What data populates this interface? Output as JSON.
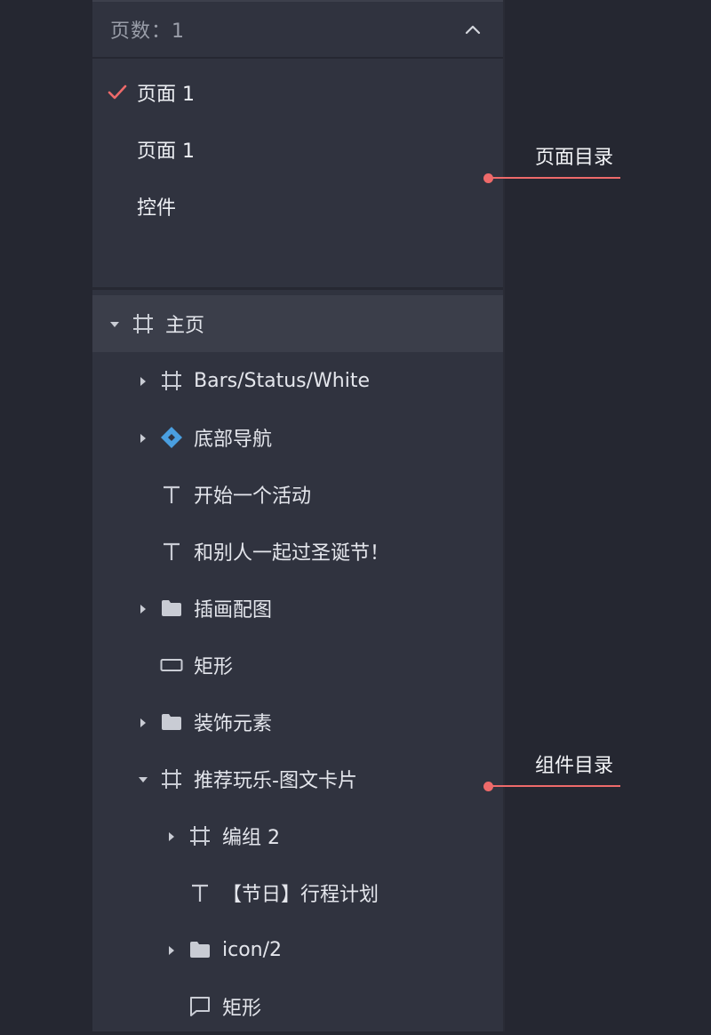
{
  "header": {
    "title": "页数：1"
  },
  "pages": [
    {
      "label": "页面 1",
      "checked": true
    },
    {
      "label": "页面 1",
      "checked": false
    },
    {
      "label": "控件",
      "checked": false
    }
  ],
  "layers": [
    {
      "label": "主页",
      "icon": "artboard-icon",
      "expand": "expanded",
      "level": 0,
      "selected": true
    },
    {
      "label": "Bars/Status/White",
      "icon": "artboard-icon",
      "expand": "collapsed",
      "level": 1
    },
    {
      "label": "底部导航",
      "icon": "symbol-diamond-icon",
      "expand": "collapsed",
      "level": 1
    },
    {
      "label": "开始一个活动",
      "icon": "text-icon",
      "expand": "none",
      "level": 1
    },
    {
      "label": "和别人一起过圣诞节！",
      "icon": "text-icon",
      "expand": "none",
      "level": 1
    },
    {
      "label": "插画配图",
      "icon": "folder-icon",
      "expand": "collapsed",
      "level": 1
    },
    {
      "label": "矩形",
      "icon": "rectangle-icon",
      "expand": "none",
      "level": 1
    },
    {
      "label": "装饰元素",
      "icon": "folder-icon",
      "expand": "collapsed",
      "level": 1
    },
    {
      "label": "推荐玩乐-图文卡片",
      "icon": "artboard-icon",
      "expand": "expanded",
      "level": 1
    },
    {
      "label": "编组 2",
      "icon": "artboard-icon",
      "expand": "collapsed",
      "level": 2
    },
    {
      "label": "【节日】行程计划",
      "icon": "text-icon",
      "expand": "none",
      "level": 2
    },
    {
      "label": "icon/2",
      "icon": "folder-icon",
      "expand": "collapsed",
      "level": 2
    },
    {
      "label": "矩形",
      "icon": "shape-path-icon",
      "expand": "none",
      "level": 2
    }
  ],
  "annotations": {
    "pages_label": "页面目录",
    "layers_label": "组件目录"
  },
  "colors": {
    "accent": "#ee6a6a",
    "panel": "#30333f",
    "background": "#252731",
    "symbol": "#4a9fe0"
  }
}
